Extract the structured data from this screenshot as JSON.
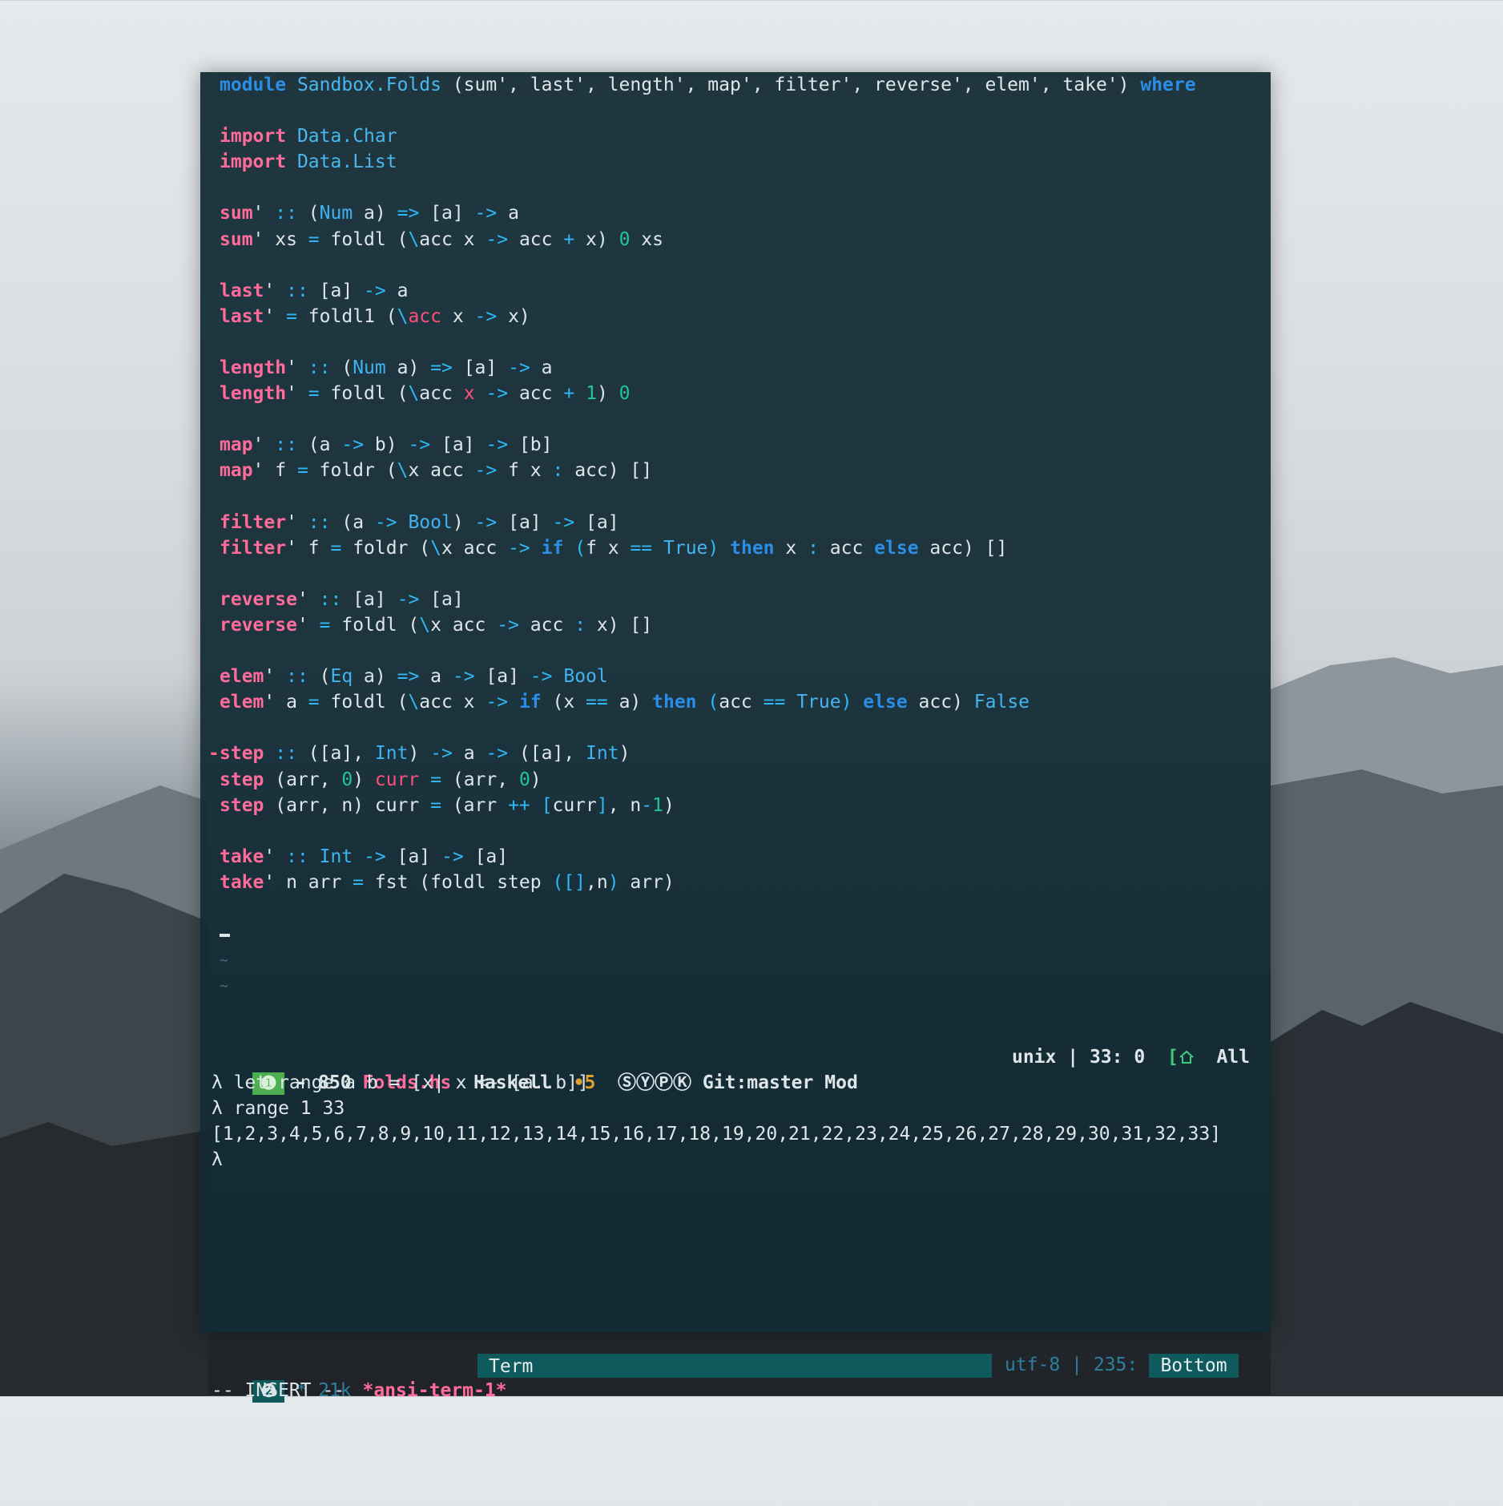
{
  "editor": {
    "code_lines": [
      {
        "k": "l",
        "fringe": "",
        "s": [
          [
            "kw",
            "module"
          ],
          [
            "t",
            " "
          ],
          [
            "mod",
            "Sandbox.Folds"
          ],
          [
            "t",
            " (sum', last', length', map', filter', reverse', elem', take') "
          ],
          [
            "kw",
            "where"
          ]
        ]
      },
      {
        "k": "l",
        "fringe": "",
        "s": []
      },
      {
        "k": "l",
        "fringe": "",
        "s": [
          [
            "imp",
            "import"
          ],
          [
            "t",
            " "
          ],
          [
            "mod",
            "Data.Char"
          ]
        ]
      },
      {
        "k": "l",
        "fringe": "",
        "s": [
          [
            "imp",
            "import"
          ],
          [
            "t",
            " "
          ],
          [
            "mod",
            "Data.List"
          ]
        ]
      },
      {
        "k": "l",
        "fringe": "",
        "s": []
      },
      {
        "k": "l",
        "fringe": "",
        "s": [
          [
            "fn",
            "sum"
          ],
          [
            "t",
            "' "
          ],
          [
            "op",
            "::"
          ],
          [
            "t",
            " ("
          ],
          [
            "ty",
            "Num"
          ],
          [
            "t",
            " a) "
          ],
          [
            "op",
            "=>"
          ],
          [
            "t",
            " [a] "
          ],
          [
            "op",
            "->"
          ],
          [
            "t",
            " a"
          ]
        ]
      },
      {
        "k": "l",
        "fringe": "",
        "s": [
          [
            "fn",
            "sum"
          ],
          [
            "t",
            "' xs "
          ],
          [
            "op",
            "="
          ],
          [
            "t",
            " foldl ("
          ],
          [
            "op",
            "\\"
          ],
          [
            "t",
            "acc x "
          ],
          [
            "op",
            "->"
          ],
          [
            "t",
            " acc "
          ],
          [
            "op",
            "+"
          ],
          [
            "t",
            " x) "
          ],
          [
            "num",
            "0"
          ],
          [
            "t",
            " xs"
          ]
        ]
      },
      {
        "k": "l",
        "fringe": "",
        "s": []
      },
      {
        "k": "l",
        "fringe": "",
        "s": [
          [
            "fn",
            "last"
          ],
          [
            "t",
            "' "
          ],
          [
            "op",
            "::"
          ],
          [
            "t",
            " [a] "
          ],
          [
            "op",
            "->"
          ],
          [
            "t",
            " a"
          ]
        ]
      },
      {
        "k": "l",
        "fringe": "",
        "s": [
          [
            "fn",
            "last"
          ],
          [
            "t",
            "' "
          ],
          [
            "op",
            "="
          ],
          [
            "t",
            " foldl1 ("
          ],
          [
            "op",
            "\\"
          ],
          [
            "var",
            "acc"
          ],
          [
            "t",
            " x "
          ],
          [
            "op",
            "->"
          ],
          [
            "t",
            " x)"
          ]
        ]
      },
      {
        "k": "l",
        "fringe": "",
        "s": []
      },
      {
        "k": "l",
        "fringe": "",
        "s": [
          [
            "fn",
            "length"
          ],
          [
            "t",
            "' "
          ],
          [
            "op",
            "::"
          ],
          [
            "t",
            " ("
          ],
          [
            "ty",
            "Num"
          ],
          [
            "t",
            " a) "
          ],
          [
            "op",
            "=>"
          ],
          [
            "t",
            " [a] "
          ],
          [
            "op",
            "->"
          ],
          [
            "t",
            " a"
          ]
        ]
      },
      {
        "k": "l",
        "fringe": "",
        "s": [
          [
            "fn",
            "length"
          ],
          [
            "t",
            "' "
          ],
          [
            "op",
            "="
          ],
          [
            "t",
            " foldl ("
          ],
          [
            "op",
            "\\"
          ],
          [
            "t",
            "acc "
          ],
          [
            "var",
            "x"
          ],
          [
            "t",
            " "
          ],
          [
            "op",
            "->"
          ],
          [
            "t",
            " acc "
          ],
          [
            "op",
            "+"
          ],
          [
            "t",
            " "
          ],
          [
            "num",
            "1"
          ],
          [
            "t",
            ") "
          ],
          [
            "num",
            "0"
          ]
        ]
      },
      {
        "k": "l",
        "fringe": "",
        "s": []
      },
      {
        "k": "l",
        "fringe": "",
        "s": [
          [
            "fn",
            "map"
          ],
          [
            "t",
            "' "
          ],
          [
            "op",
            "::"
          ],
          [
            "t",
            " (a "
          ],
          [
            "op",
            "->"
          ],
          [
            "t",
            " b) "
          ],
          [
            "op",
            "->"
          ],
          [
            "t",
            " [a] "
          ],
          [
            "op",
            "->"
          ],
          [
            "t",
            " [b]"
          ]
        ]
      },
      {
        "k": "l",
        "fringe": "",
        "s": [
          [
            "fn",
            "map"
          ],
          [
            "t",
            "' f "
          ],
          [
            "op",
            "="
          ],
          [
            "t",
            " foldr ("
          ],
          [
            "op",
            "\\"
          ],
          [
            "t",
            "x acc "
          ],
          [
            "op",
            "->"
          ],
          [
            "t",
            " f x "
          ],
          [
            "op",
            ":"
          ],
          [
            "t",
            " acc) []"
          ]
        ]
      },
      {
        "k": "l",
        "fringe": "",
        "s": []
      },
      {
        "k": "l",
        "fringe": "",
        "s": [
          [
            "fn",
            "filter"
          ],
          [
            "t",
            "' "
          ],
          [
            "op",
            "::"
          ],
          [
            "t",
            " (a "
          ],
          [
            "op",
            "->"
          ],
          [
            "t",
            " "
          ],
          [
            "ty",
            "Bool"
          ],
          [
            "t",
            ") "
          ],
          [
            "op",
            "->"
          ],
          [
            "t",
            " [a] "
          ],
          [
            "op",
            "->"
          ],
          [
            "t",
            " [a]"
          ]
        ]
      },
      {
        "k": "l",
        "fringe": "",
        "s": [
          [
            "fn",
            "filter"
          ],
          [
            "t",
            "' f "
          ],
          [
            "op",
            "="
          ],
          [
            "t",
            " foldr ("
          ],
          [
            "op",
            "\\"
          ],
          [
            "t",
            "x acc "
          ],
          [
            "op",
            "->"
          ],
          [
            "t",
            " "
          ],
          [
            "kw",
            "if"
          ],
          [
            "t",
            " "
          ],
          [
            "op",
            "("
          ],
          [
            "t",
            "f x "
          ],
          [
            "op",
            "=="
          ],
          [
            "t",
            " "
          ],
          [
            "bool",
            "True"
          ],
          [
            "op",
            ")"
          ],
          [
            "t",
            " "
          ],
          [
            "kw",
            "then"
          ],
          [
            "t",
            " x "
          ],
          [
            "op",
            ":"
          ],
          [
            "t",
            " acc "
          ],
          [
            "kw",
            "else"
          ],
          [
            "t",
            " acc) []"
          ]
        ]
      },
      {
        "k": "l",
        "fringe": "",
        "s": []
      },
      {
        "k": "l",
        "fringe": "",
        "s": [
          [
            "fn",
            "reverse"
          ],
          [
            "t",
            "' "
          ],
          [
            "op",
            "::"
          ],
          [
            "t",
            " [a] "
          ],
          [
            "op",
            "->"
          ],
          [
            "t",
            " [a]"
          ]
        ]
      },
      {
        "k": "l",
        "fringe": "",
        "s": [
          [
            "fn",
            "reverse"
          ],
          [
            "t",
            "' "
          ],
          [
            "op",
            "="
          ],
          [
            "t",
            " foldl ("
          ],
          [
            "op",
            "\\"
          ],
          [
            "t",
            "x acc "
          ],
          [
            "op",
            "->"
          ],
          [
            "t",
            " acc "
          ],
          [
            "op",
            ":"
          ],
          [
            "t",
            " x) []"
          ]
        ]
      },
      {
        "k": "l",
        "fringe": "",
        "s": []
      },
      {
        "k": "l",
        "fringe": "",
        "s": [
          [
            "fn",
            "elem"
          ],
          [
            "t",
            "' "
          ],
          [
            "op",
            "::"
          ],
          [
            "t",
            " ("
          ],
          [
            "ty",
            "Eq"
          ],
          [
            "t",
            " a) "
          ],
          [
            "op",
            "=>"
          ],
          [
            "t",
            " a "
          ],
          [
            "op",
            "->"
          ],
          [
            "t",
            " [a] "
          ],
          [
            "op",
            "->"
          ],
          [
            "t",
            " "
          ],
          [
            "ty",
            "Bool"
          ]
        ]
      },
      {
        "k": "l",
        "fringe": "",
        "s": [
          [
            "fn",
            "elem"
          ],
          [
            "t",
            "' a "
          ],
          [
            "op",
            "="
          ],
          [
            "t",
            " foldl ("
          ],
          [
            "op",
            "\\"
          ],
          [
            "t",
            "acc x "
          ],
          [
            "op",
            "->"
          ],
          [
            "t",
            " "
          ],
          [
            "kw",
            "if"
          ],
          [
            "t",
            " (x "
          ],
          [
            "op",
            "=="
          ],
          [
            "t",
            " a) "
          ],
          [
            "kw",
            "then"
          ],
          [
            "t",
            " "
          ],
          [
            "op",
            "("
          ],
          [
            "t",
            "acc "
          ],
          [
            "op",
            "=="
          ],
          [
            "t",
            " "
          ],
          [
            "bool",
            "True"
          ],
          [
            "op",
            ")"
          ],
          [
            "t",
            " "
          ],
          [
            "kw",
            "else"
          ],
          [
            "t",
            " acc) "
          ],
          [
            "bool",
            "False"
          ]
        ]
      },
      {
        "k": "l",
        "fringe": "",
        "s": []
      },
      {
        "k": "l",
        "fringe": "-",
        "s": [
          [
            "fn",
            "step"
          ],
          [
            "t",
            " "
          ],
          [
            "op",
            "::"
          ],
          [
            "t",
            " ([a], "
          ],
          [
            "ty",
            "Int"
          ],
          [
            "t",
            ") "
          ],
          [
            "op",
            "->"
          ],
          [
            "t",
            " a "
          ],
          [
            "op",
            "->"
          ],
          [
            "t",
            " ([a], "
          ],
          [
            "ty",
            "Int"
          ],
          [
            "t",
            ")"
          ]
        ]
      },
      {
        "k": "l",
        "fringe": "",
        "s": [
          [
            "fn",
            "step"
          ],
          [
            "t",
            " (arr, "
          ],
          [
            "num",
            "0"
          ],
          [
            "t",
            ") "
          ],
          [
            "var",
            "curr"
          ],
          [
            "t",
            " "
          ],
          [
            "op",
            "="
          ],
          [
            "t",
            " (arr, "
          ],
          [
            "num",
            "0"
          ],
          [
            "t",
            ")"
          ]
        ]
      },
      {
        "k": "l",
        "fringe": "",
        "s": [
          [
            "fn",
            "step"
          ],
          [
            "t",
            " (arr, n) curr "
          ],
          [
            "op",
            "="
          ],
          [
            "t",
            " (arr "
          ],
          [
            "op",
            "++"
          ],
          [
            "t",
            " "
          ],
          [
            "op",
            "["
          ],
          [
            "t",
            "curr"
          ],
          [
            "op",
            "]"
          ],
          [
            "t",
            ", n"
          ],
          [
            "op",
            "-"
          ],
          [
            "num",
            "1"
          ],
          [
            "t",
            ")"
          ]
        ]
      },
      {
        "k": "l",
        "fringe": "",
        "s": []
      },
      {
        "k": "l",
        "fringe": "",
        "s": [
          [
            "fn",
            "take"
          ],
          [
            "t",
            "' "
          ],
          [
            "op",
            "::"
          ],
          [
            "t",
            " "
          ],
          [
            "ty",
            "Int"
          ],
          [
            "t",
            " "
          ],
          [
            "op",
            "->"
          ],
          [
            "t",
            " [a] "
          ],
          [
            "op",
            "->"
          ],
          [
            "t",
            " [a]"
          ]
        ]
      },
      {
        "k": "l",
        "fringe": "",
        "s": [
          [
            "fn",
            "take"
          ],
          [
            "t",
            "' n arr "
          ],
          [
            "op",
            "="
          ],
          [
            "t",
            " fst (foldl step "
          ],
          [
            "op",
            "([]"
          ],
          [
            "t",
            ",n"
          ],
          [
            "op",
            ")"
          ],
          [
            "t",
            " arr)"
          ]
        ]
      },
      {
        "k": "l",
        "fringe": "",
        "s": []
      },
      {
        "k": "cursor"
      },
      {
        "k": "tilde",
        "s": [
          [
            "t",
            "~"
          ]
        ]
      },
      {
        "k": "tilde",
        "s": [
          [
            "t",
            "~"
          ]
        ]
      }
    ]
  },
  "modeline_top": {
    "badge": "❶",
    "dash": "-",
    "size": "850",
    "filename": "Folds.hs",
    "major_mode": "Haskell",
    "flycheck": "•5",
    "minor_modes": "ⓈⓎⓅⓀ",
    "git": "Git:master",
    "modified": "Mod",
    "eol": "unix",
    "sep": "|",
    "position": "33: 0",
    "icon_text": "[",
    "scroll": "All"
  },
  "repl": {
    "lines": [
      "λ let range a b = [x| x <- [a..b]]",
      "λ range 1 33",
      "[1,2,3,4,5,6,7,8,9,10,11,12,13,14,15,16,17,18,19,20,21,22,23,24,25,26,27,28,29,30,31,32,33]",
      "λ"
    ]
  },
  "modeline_bottom": {
    "badge": "❷",
    "star": "*",
    "size": "21k",
    "buffer": "*ansi-term-1*",
    "mode": "Term",
    "encoding": "utf-8",
    "sep": "|",
    "position": "235: 2",
    "scroll": "Bottom"
  },
  "echo_area": "-- INSERT --",
  "colors": {
    "keyword": "#2a8ee6",
    "function": "#ff6b9a",
    "operator": "#2fb8f5",
    "type": "#41b2f0",
    "number": "#22c49a",
    "background": "#122a34",
    "accent_teal": "#0f5a5d",
    "badge_green": "#4caf50"
  }
}
